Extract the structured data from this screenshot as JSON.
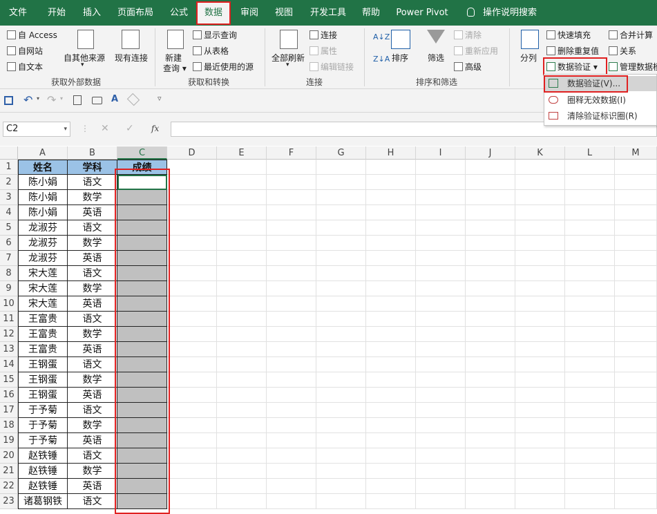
{
  "menu": {
    "tabs": [
      "文件",
      "开始",
      "插入",
      "页面布局",
      "公式",
      "数据",
      "审阅",
      "视图",
      "开发工具",
      "帮助",
      "Power Pivot"
    ],
    "active": "数据",
    "search": "操作说明搜索"
  },
  "ribbon": {
    "get_external": {
      "access": "自 Access",
      "web": "自网站",
      "text": "自文本",
      "other": "自其他来源",
      "existing": "现有连接",
      "group": "获取外部数据"
    },
    "get_transform": {
      "new_query_1": "新建",
      "new_query_2": "查询",
      "show_query": "显示查询",
      "from_table": "从表格",
      "recent": "最近使用的源",
      "group": "获取和转换"
    },
    "connections": {
      "refresh": "全部刷新",
      "connections": "连接",
      "properties": "属性",
      "edit_links": "编辑链接",
      "group": "连接"
    },
    "sort_filter": {
      "sort": "排序",
      "filter": "筛选",
      "clear": "清除",
      "reapply": "重新应用",
      "advanced": "高级",
      "group": "排序和筛选"
    },
    "tools": {
      "split": "分列",
      "flash_fill": "快速填充",
      "remove_dup": "删除重复值",
      "data_validation": "数据验证",
      "consolidate": "合并计算",
      "relationships": "关系",
      "manage_model": "管理数据模型"
    }
  },
  "dropdown": {
    "items": [
      "数据验证(V)...",
      "圈释无效数据(I)",
      "清除验证标识圈(R)"
    ]
  },
  "formula_bar": {
    "name_box": "C2",
    "fx": "fx",
    "value": ""
  },
  "columns": [
    "A",
    "B",
    "C",
    "D",
    "E",
    "F",
    "G",
    "H",
    "I",
    "J",
    "K",
    "L",
    "M"
  ],
  "table": {
    "headers": [
      "姓名",
      "学科",
      "成绩"
    ],
    "rows": [
      [
        "陈小娟",
        "语文"
      ],
      [
        "陈小娟",
        "数学"
      ],
      [
        "陈小娟",
        "英语"
      ],
      [
        "龙淑芬",
        "语文"
      ],
      [
        "龙淑芬",
        "数学"
      ],
      [
        "龙淑芬",
        "英语"
      ],
      [
        "宋大莲",
        "语文"
      ],
      [
        "宋大莲",
        "数学"
      ],
      [
        "宋大莲",
        "英语"
      ],
      [
        "王富贵",
        "语文"
      ],
      [
        "王富贵",
        "数学"
      ],
      [
        "王富贵",
        "英语"
      ],
      [
        "王钢蛋",
        "语文"
      ],
      [
        "王钢蛋",
        "数学"
      ],
      [
        "王钢蛋",
        "英语"
      ],
      [
        "于予菊",
        "语文"
      ],
      [
        "于予菊",
        "数学"
      ],
      [
        "于予菊",
        "英语"
      ],
      [
        "赵铁锤",
        "语文"
      ],
      [
        "赵铁锤",
        "数学"
      ],
      [
        "赵铁锤",
        "英语"
      ],
      [
        "诸葛钢铁",
        "语文"
      ]
    ]
  },
  "row_numbers": [
    "1",
    "2",
    "3",
    "4",
    "5",
    "6",
    "7",
    "8",
    "9",
    "10",
    "11",
    "12",
    "13",
    "14",
    "15",
    "16",
    "17",
    "18",
    "19",
    "20",
    "21",
    "22",
    "23"
  ],
  "colors": {
    "brand": "#217346",
    "header_fill": "#9bc2e6",
    "empty_fill": "#c0c0c0",
    "highlight": "#e02020"
  }
}
